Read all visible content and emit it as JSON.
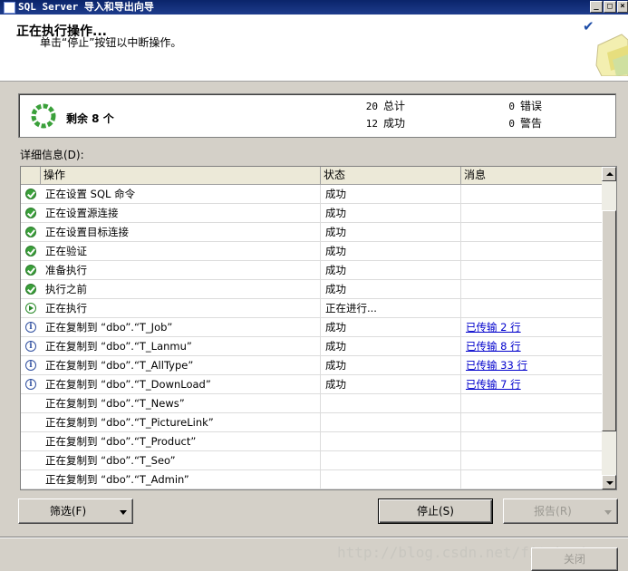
{
  "window": {
    "title": "SQL Server 导入和导出向导"
  },
  "header": {
    "title": "正在执行操作...",
    "subtitle": "单击“停止”按钮以中断操作。"
  },
  "summary": {
    "remaining_label": "剩余 8 个",
    "total_count": "20",
    "total_label": "总计",
    "success_count": "12",
    "success_label": "成功",
    "error_count": "0",
    "error_label": "错误",
    "warning_count": "0",
    "warning_label": "警告"
  },
  "details": {
    "label": "详细信息(D):",
    "columns": [
      "操作",
      "状态",
      "消息"
    ],
    "rows": [
      {
        "icon": "success-icon",
        "action": "正在设置 SQL 命令",
        "status": "成功",
        "message": ""
      },
      {
        "icon": "success-icon",
        "action": "正在设置源连接",
        "status": "成功",
        "message": ""
      },
      {
        "icon": "success-icon",
        "action": "正在设置目标连接",
        "status": "成功",
        "message": ""
      },
      {
        "icon": "success-icon",
        "action": "正在验证",
        "status": "成功",
        "message": ""
      },
      {
        "icon": "success-icon",
        "action": "准备执行",
        "status": "成功",
        "message": ""
      },
      {
        "icon": "success-icon",
        "action": "执行之前",
        "status": "成功",
        "message": ""
      },
      {
        "icon": "running-icon",
        "action": "正在执行",
        "status": "正在进行...",
        "message": ""
      },
      {
        "icon": "info-icon",
        "action": "正在复制到 “dbo”.“T_Job”",
        "status": "成功",
        "message": "已传输 2 行"
      },
      {
        "icon": "info-icon",
        "action": "正在复制到 “dbo”.“T_Lanmu”",
        "status": "成功",
        "message": "已传输 8 行"
      },
      {
        "icon": "info-icon",
        "action": "正在复制到 “dbo”.“T_AllType”",
        "status": "成功",
        "message": "已传输 33 行"
      },
      {
        "icon": "info-icon",
        "action": "正在复制到 “dbo”.“T_DownLoad”",
        "status": "成功",
        "message": "已传输 7 行"
      },
      {
        "icon": "",
        "action": "正在复制到 “dbo”.“T_News”",
        "status": "",
        "message": ""
      },
      {
        "icon": "",
        "action": "正在复制到 “dbo”.“T_PictureLink”",
        "status": "",
        "message": ""
      },
      {
        "icon": "",
        "action": "正在复制到 “dbo”.“T_Product”",
        "status": "",
        "message": ""
      },
      {
        "icon": "",
        "action": "正在复制到 “dbo”.“T_Seo”",
        "status": "",
        "message": ""
      },
      {
        "icon": "",
        "action": "正在复制到 “dbo”.“T_Admin”",
        "status": "",
        "message": ""
      }
    ]
  },
  "buttons": {
    "filter": "筛选(F)",
    "stop": "停止(S)",
    "report": "报告(R)",
    "close": "关闭"
  },
  "watermark": "http://blog.csdn.net/fitche_byu",
  "colors": {
    "link": "#0000cc",
    "success": "#3aa03a",
    "titlebar": "#0a246a"
  }
}
